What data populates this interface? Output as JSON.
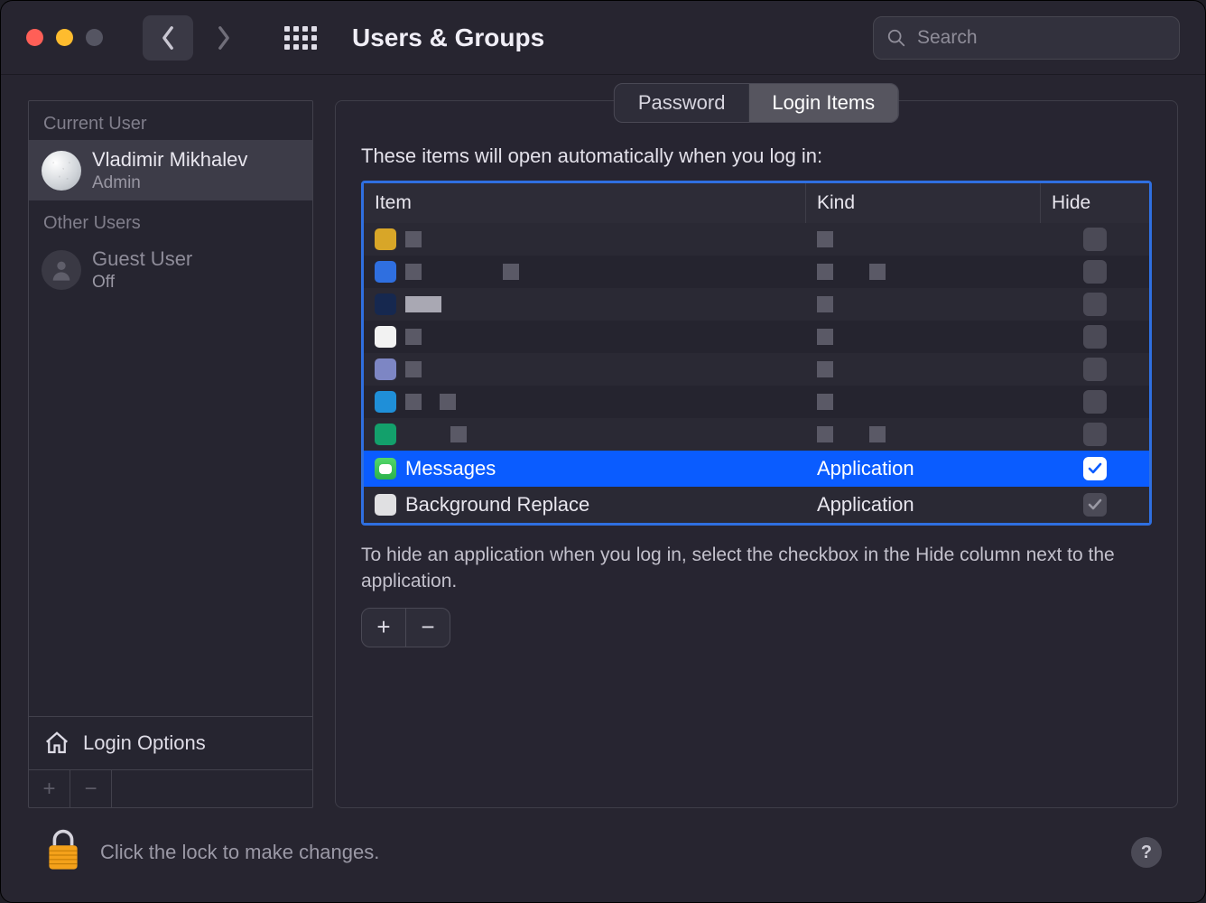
{
  "window": {
    "title": "Users & Groups"
  },
  "search": {
    "placeholder": "Search"
  },
  "sidebar": {
    "current_user_header": "Current User",
    "other_users_header": "Other Users",
    "current_user": {
      "name": "Vladimir Mikhalev",
      "role": "Admin"
    },
    "other_users": [
      {
        "name": "Guest User",
        "role": "Off"
      }
    ],
    "login_options_label": "Login Options"
  },
  "tabs": {
    "password": "Password",
    "login_items": "Login Items"
  },
  "panel": {
    "description": "These items will open automatically when you log in:",
    "columns": {
      "item": "Item",
      "kind": "Kind",
      "hide": "Hide"
    },
    "rows": [
      {
        "item": "Messages",
        "kind": "Application",
        "hide_checked": true,
        "selected": true,
        "icon": "messages"
      },
      {
        "item": "Background Replace",
        "kind": "Application",
        "hide_checked": true,
        "selected": false,
        "icon": "bg"
      }
    ],
    "hint": "To hide an application when you log in, select the checkbox in the Hide column next to the application."
  },
  "lock_hint": "Click the lock to make changes.",
  "glyphs": {
    "plus": "+",
    "minus": "−",
    "help": "?"
  }
}
